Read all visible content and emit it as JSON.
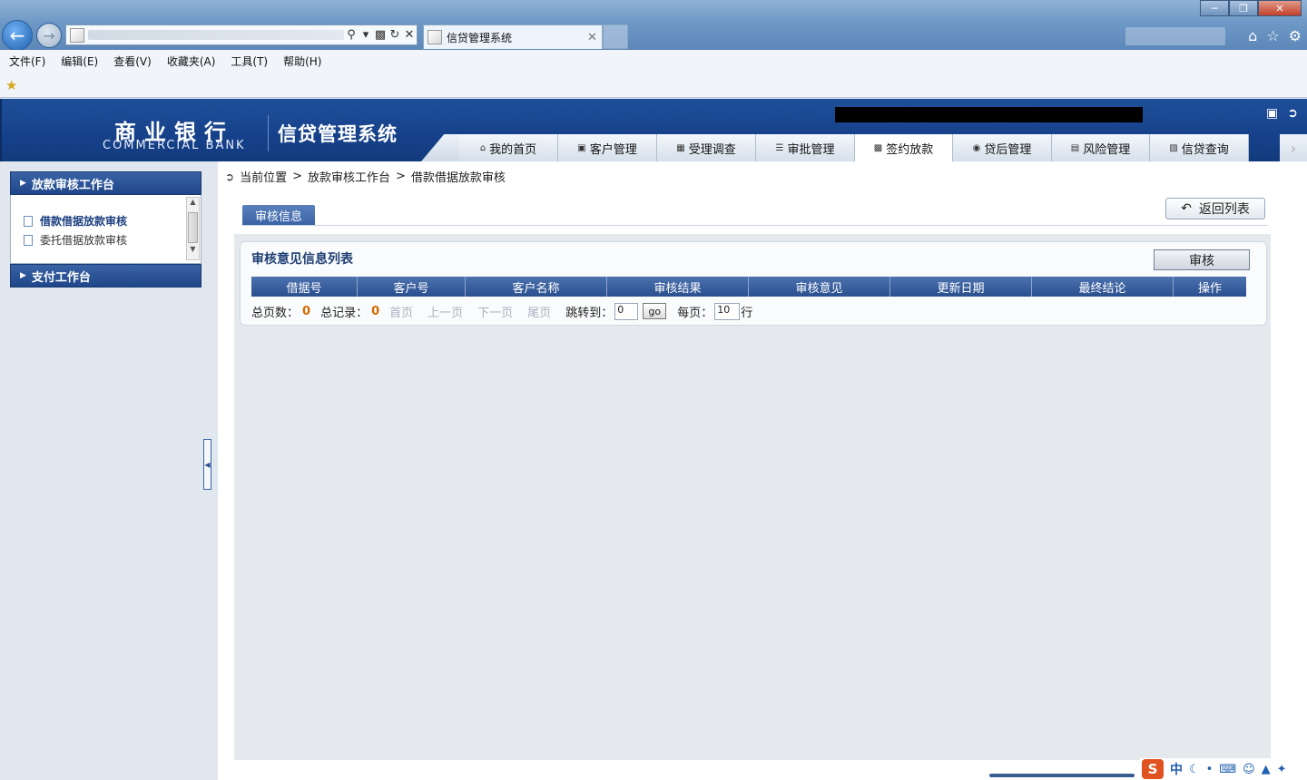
{
  "browser": {
    "tab_title": "信贷管理系统",
    "menu": [
      "文件(F)",
      "编辑(E)",
      "查看(V)",
      "收藏夹(A)",
      "工具(T)",
      "帮助(H)"
    ]
  },
  "header": {
    "bank_cn": "商业银行",
    "bank_en": "COMMERCIAL BANK",
    "system_title": "信贷管理系统"
  },
  "nav": {
    "tabs": [
      "我的首页",
      "客户管理",
      "受理调查",
      "审批管理",
      "签约放款",
      "贷后管理",
      "风险管理",
      "信贷查询"
    ],
    "active": "签约放款"
  },
  "sidebar": {
    "section1": "放款审核工作台",
    "items": [
      "借款借据放款审核",
      "委托借据放款审核"
    ],
    "section2": "支付工作台"
  },
  "breadcrumb": {
    "root": "当前位置",
    "separator": ">",
    "level1": "放款审核工作台",
    "level2": "借款借据放款审核"
  },
  "main": {
    "tab_label": "审核信息",
    "return_label": "返回列表",
    "panel_title": "审核意见信息列表",
    "audit_button": "审核",
    "columns": [
      "借据号",
      "客户号",
      "客户名称",
      "审核结果",
      "审核意见",
      "更新日期",
      "最终结论",
      "操作"
    ]
  },
  "pager": {
    "total_pages_label": "总页数：",
    "total_pages": "0",
    "total_records_label": "总记录：",
    "total_records": "0",
    "first": "首页",
    "prev": "上一页",
    "next": "下一页",
    "last": "尾页",
    "goto_label": "跳转到：",
    "goto_value": "0",
    "go_label": "go",
    "pagesize_label": "每页：",
    "pagesize_value": "10",
    "rows_unit": "行"
  },
  "ime": {
    "mode": "中"
  }
}
